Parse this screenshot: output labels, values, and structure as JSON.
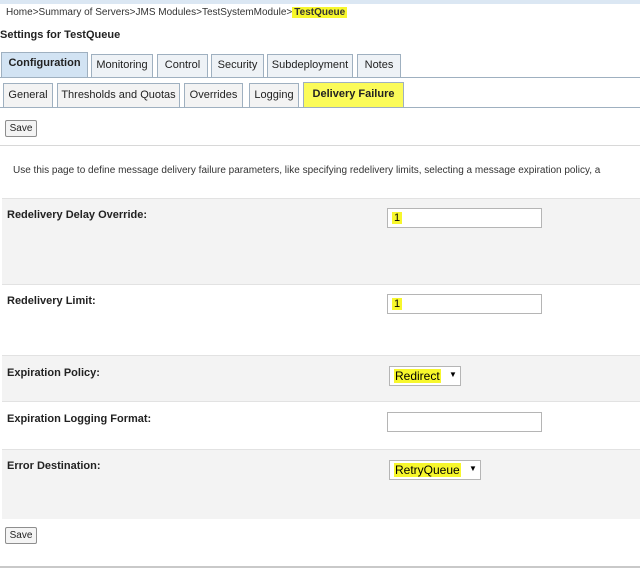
{
  "breadcrumb": {
    "items": [
      "Home",
      "Summary of Servers",
      "JMS Modules",
      "TestSystemModule"
    ],
    "current": "TestQueue",
    "separator": ">"
  },
  "page_title": "Settings for TestQueue",
  "outer_tabs": [
    {
      "label": "Configuration",
      "active": true
    },
    {
      "label": "Monitoring",
      "active": false
    },
    {
      "label": "Control",
      "active": false
    },
    {
      "label": "Security",
      "active": false
    },
    {
      "label": "Subdeployment",
      "active": false
    },
    {
      "label": "Notes",
      "active": false
    }
  ],
  "inner_tabs": [
    {
      "label": "General",
      "active": false
    },
    {
      "label": "Thresholds and Quotas",
      "active": false
    },
    {
      "label": "Overrides",
      "active": false
    },
    {
      "label": "Logging",
      "active": false
    },
    {
      "label": "Delivery Failure",
      "active": true
    }
  ],
  "save_label": "Save",
  "description": "Use this page to define message delivery failure parameters, like specifying redelivery limits, selecting a message expiration policy, a",
  "fields": {
    "redelivery_delay_override": {
      "label": "Redelivery Delay Override:",
      "value": "1"
    },
    "redelivery_limit": {
      "label": "Redelivery Limit:",
      "value": "1"
    },
    "expiration_policy": {
      "label": "Expiration Policy:",
      "value": "Redirect"
    },
    "expiration_logging_format": {
      "label": "Expiration Logging Format:",
      "value": ""
    },
    "error_destination": {
      "label": "Error Destination:",
      "value": "RetryQueue"
    }
  },
  "colors": {
    "highlight": "#f7f72c",
    "active_tab_bg": "#d2e3f3",
    "tab_border": "#9fb0c0"
  },
  "icons": {
    "dropdown": "▼"
  }
}
